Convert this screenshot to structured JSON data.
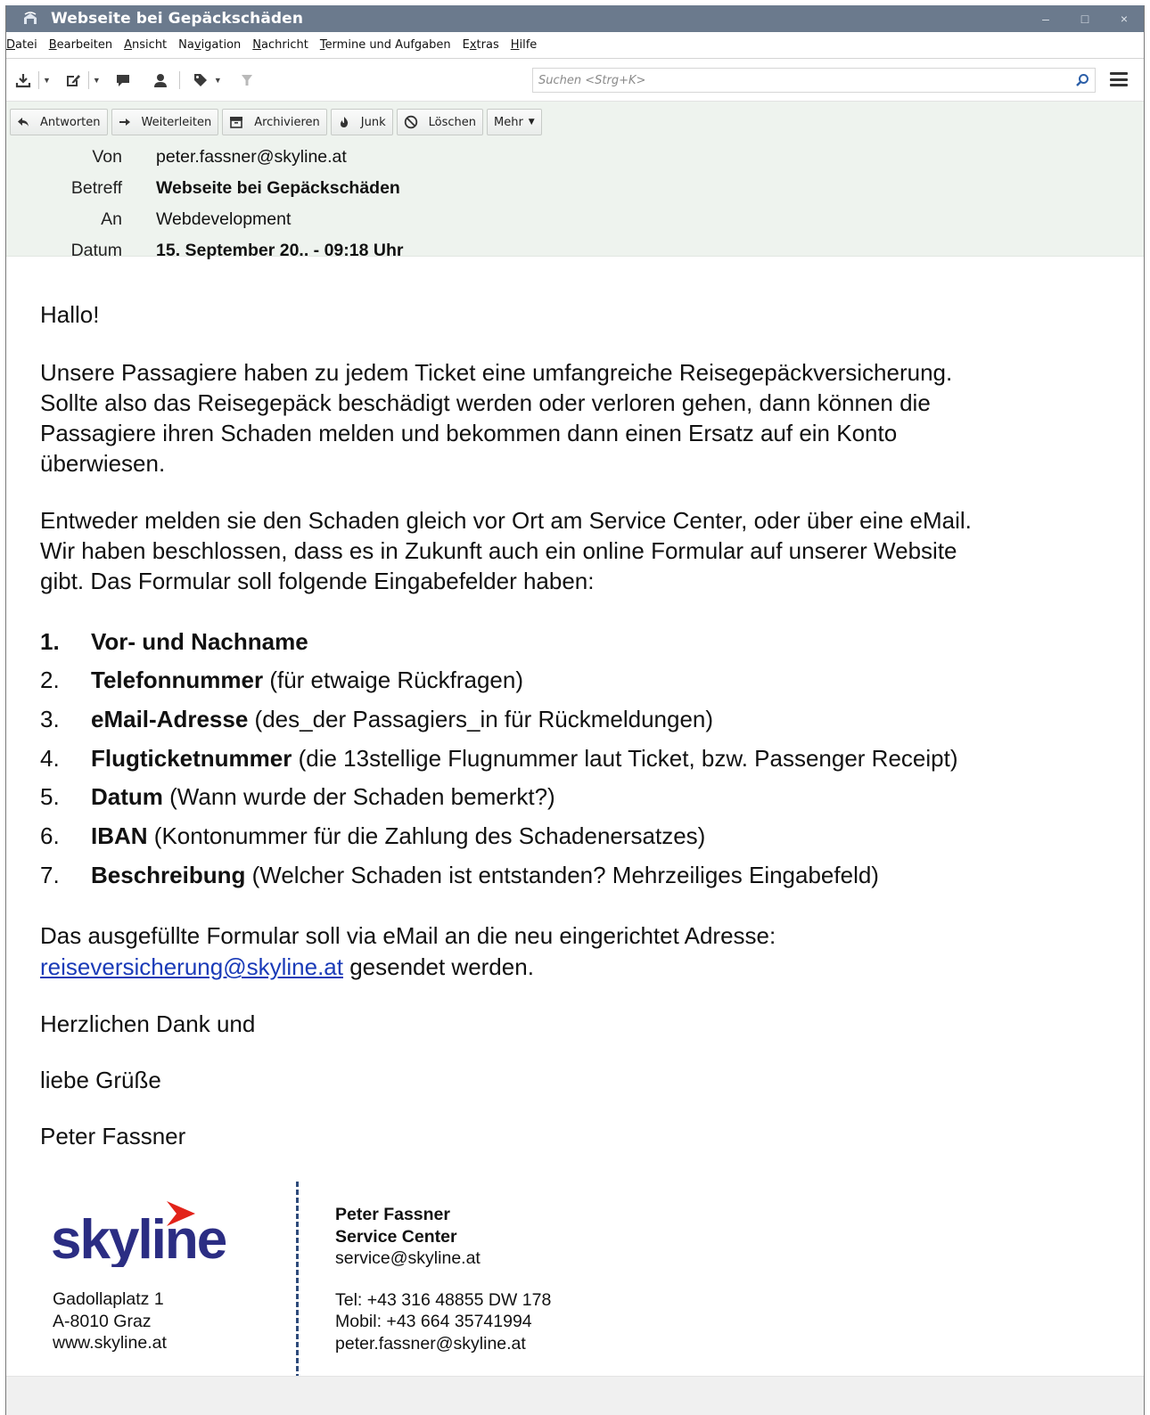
{
  "window": {
    "title": "Webseite bei Gepäckschäden",
    "controls": {
      "minimize": "–",
      "maximize": "□",
      "close": "×"
    }
  },
  "menubar": {
    "items": [
      {
        "pre": "",
        "key": "D",
        "post": "atei"
      },
      {
        "pre": "",
        "key": "B",
        "post": "earbeiten"
      },
      {
        "pre": "",
        "key": "A",
        "post": "nsicht"
      },
      {
        "pre": "Na",
        "key": "v",
        "post": "igation"
      },
      {
        "pre": "",
        "key": "N",
        "post": "achricht"
      },
      {
        "pre": "",
        "key": "T",
        "post": "ermine und Aufgaben"
      },
      {
        "pre": "E",
        "key": "x",
        "post": "tras"
      },
      {
        "pre": "",
        "key": "H",
        "post": "ilfe"
      }
    ]
  },
  "toolbar": {
    "icons": [
      "download-icon",
      "write-icon",
      "chat-icon",
      "address-book-icon",
      "tag-icon",
      "filter-icon"
    ],
    "search_placeholder": "Suchen <Strg+K>"
  },
  "actions": [
    {
      "label": "Antworten",
      "icon": "reply-icon"
    },
    {
      "label": "Weiterleiten",
      "icon": "forward-icon"
    },
    {
      "label": "Archivieren",
      "icon": "archive-icon"
    },
    {
      "label": "Junk",
      "icon": "junk-icon"
    },
    {
      "label": "Löschen",
      "icon": "delete-icon"
    },
    {
      "label": "Mehr",
      "icon": "chevron-down-icon"
    }
  ],
  "headers": {
    "from_label": "Von",
    "from_value": "peter.fassner@skyline.at",
    "subject_label": "Betreff",
    "subject_value": "Webseite bei Gepäckschäden",
    "to_label": "An",
    "to_value": "Webdevelopment",
    "date_label": "Datum",
    "date_value": "15. September 20.. - 09:18 Uhr"
  },
  "body": {
    "greeting": "Hallo!",
    "para1": [
      "Unsere Passagiere haben zu jedem Ticket eine umfangreiche Reisegepäckversicherung.",
      "Sollte also das Reisegepäck beschädigt werden oder verloren gehen, dann können die",
      "Passagiere ihren Schaden melden und bekommen dann einen Ersatz auf ein Konto",
      "überwiesen."
    ],
    "para2": [
      "Entweder melden sie den Schaden gleich vor Ort am Service Center, oder über eine eMail.",
      "Wir haben beschlossen, dass es in Zukunft auch ein online Formular auf unserer Website",
      "gibt. Das Formular soll folgende Eingabefelder haben:"
    ],
    "list": [
      {
        "num": "1.",
        "field": "Vor- und Nachname",
        "note": ""
      },
      {
        "num": "2.",
        "field": "Telefonnummer",
        "note": " (für etwaige Rückfragen)"
      },
      {
        "num": "3.",
        "field": "eMail-Adresse",
        "note": " (des_der Passagiers_in für Rückmeldungen)"
      },
      {
        "num": "4.",
        "field": "Flugticketnummer",
        "note": " (die 13stellige Flugnummer laut Ticket, bzw. Passenger Receipt)"
      },
      {
        "num": "5.",
        "field": "Datum",
        "note": " (Wann wurde der Schaden bemerkt?)"
      },
      {
        "num": "6.",
        "field": "IBAN",
        "note": " (Kontonummer für die Zahlung des Schadenersatzes)"
      },
      {
        "num": "7.",
        "field": "Beschreibung",
        "note": " (Welcher Schaden ist entstanden? Mehrzeiliges Eingabefeld)"
      }
    ],
    "para3_line1": "Das ausgefüllte Formular soll via eMail an die neu eingerichtet Adresse:",
    "para3_link": "reiseversicherung@skyline.at",
    "para3_rest": " gesendet werden.",
    "closing1": "Herzlichen Dank und",
    "closing2": "liebe Grüße",
    "closing3": "Peter Fassner"
  },
  "signature": {
    "logo_text": "skyline",
    "left": [
      "Gadollaplatz 1",
      "A-8010 Graz",
      "www.skyline.at"
    ],
    "name": "Peter Fassner",
    "dept": "Service Center",
    "service_email": "service@skyline.at",
    "tel": "Tel: +43 316 48855 DW 178",
    "mobil": "Mobil: +43 664 35741994",
    "email": "peter.fassner@skyline.at"
  },
  "colors": {
    "titlebar": "#6b7a8d",
    "header_pane": "#eef3ee",
    "link": "#1a3bb8",
    "logo_navy": "#2b2d83",
    "logo_red": "#e2231a"
  }
}
